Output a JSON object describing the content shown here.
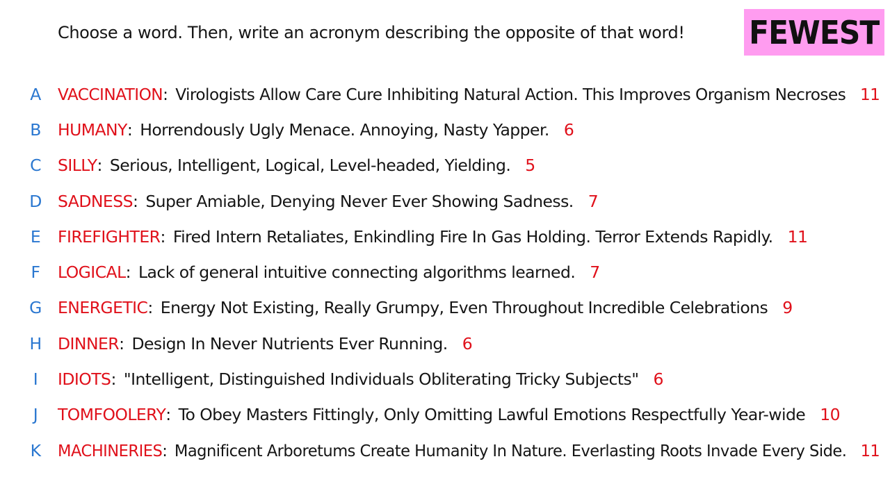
{
  "instruction": "Choose a word. Then, write an acronym describing the opposite of that word!",
  "badge": {
    "label": "FEWEST",
    "color": "#ff9cf0"
  },
  "colors": {
    "letter": "#2a77d0",
    "word": "#e0101a",
    "count": "#e0101a",
    "text": "#151515"
  },
  "items": [
    {
      "letter": "A",
      "word": "VACCINATION",
      "colon": ":",
      "acronym": "Virologists Allow Care Cure Inhibiting Natural Action. This Improves Organism Necroses",
      "count": "11"
    },
    {
      "letter": "B",
      "word": "HUMANY",
      "colon": ":",
      "acronym": "Horrendously Ugly Menace. Annoying, Nasty Yapper.",
      "count": "6"
    },
    {
      "letter": "C",
      "word": "SILLY",
      "colon": ":",
      "acronym": "Serious, Intelligent, Logical, Level-headed, Yielding.",
      "count": "5"
    },
    {
      "letter": "D",
      "word": "SADNESS",
      "colon": ":",
      "acronym": "Super Amiable, Denying Never Ever Showing Sadness.",
      "count": "7"
    },
    {
      "letter": "E",
      "word": "FIREFIGHTER",
      "colon": ":",
      "acronym": "Fired Intern Retaliates, Enkindling Fire In Gas Holding. Terror Extends Rapidly.",
      "count": "11"
    },
    {
      "letter": "F",
      "word": "LOGICAL",
      "colon": ":",
      "acronym": "Lack of general intuitive connecting algorithms learned.",
      "count": "7"
    },
    {
      "letter": "G",
      "word": "ENERGETIC",
      "colon": ":",
      "acronym": "Energy Not Existing, Really Grumpy, Even Throughout Incredible Celebrations",
      "count": "9"
    },
    {
      "letter": "H",
      "word": "DINNER",
      "colon": ":",
      "acronym": "Design In Never Nutrients Ever Running.",
      "count": "6"
    },
    {
      "letter": "I",
      "word": "IDIOTS",
      "colon": ":",
      "acronym": "\"Intelligent, Distinguished Individuals Obliterating Tricky Subjects\"",
      "count": "6"
    },
    {
      "letter": "J",
      "word": "TOMFOOLERY",
      "colon": ":",
      "acronym": "To Obey Masters Fittingly, Only Omitting Lawful Emotions Respectfully Year-wide",
      "count": "10"
    },
    {
      "letter": "K",
      "word": "MACHINERIES",
      "colon": ":",
      "acronym": "Magnificent Arboretums Create Humanity In Nature. Everlasting Roots Invade Every Side.",
      "count": "11"
    }
  ]
}
